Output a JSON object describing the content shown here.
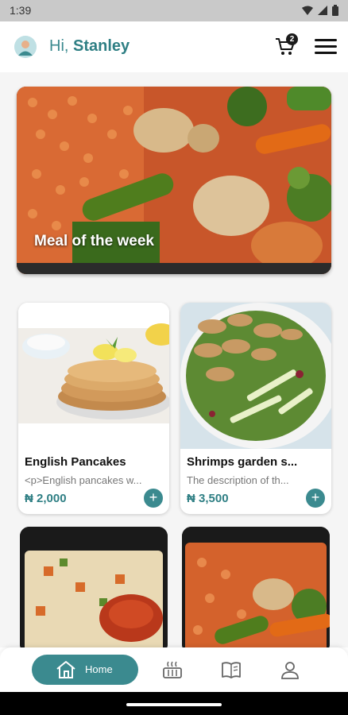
{
  "status_bar": {
    "time": "1:39"
  },
  "header": {
    "greeting": "Hi,",
    "user_name": "Stanley",
    "cart_count": "2"
  },
  "hero": {
    "title": "Meal of the week"
  },
  "meals": [
    {
      "title": "English Pancakes",
      "description": "<p>English pancakes w...",
      "price": "₦ 2,000"
    },
    {
      "title": "Shrimps garden s...",
      "description": "The description of th...",
      "price": "₦ 3,500"
    }
  ],
  "nav": {
    "home_label": "Home"
  },
  "colors": {
    "accent": "#3b8a8f",
    "status_bar": "#c9c9c9"
  },
  "icons": [
    "user-avatar-icon",
    "cart-icon",
    "menu-icon",
    "home-icon",
    "food-tray-icon",
    "book-icon",
    "profile-icon",
    "add-icon"
  ]
}
